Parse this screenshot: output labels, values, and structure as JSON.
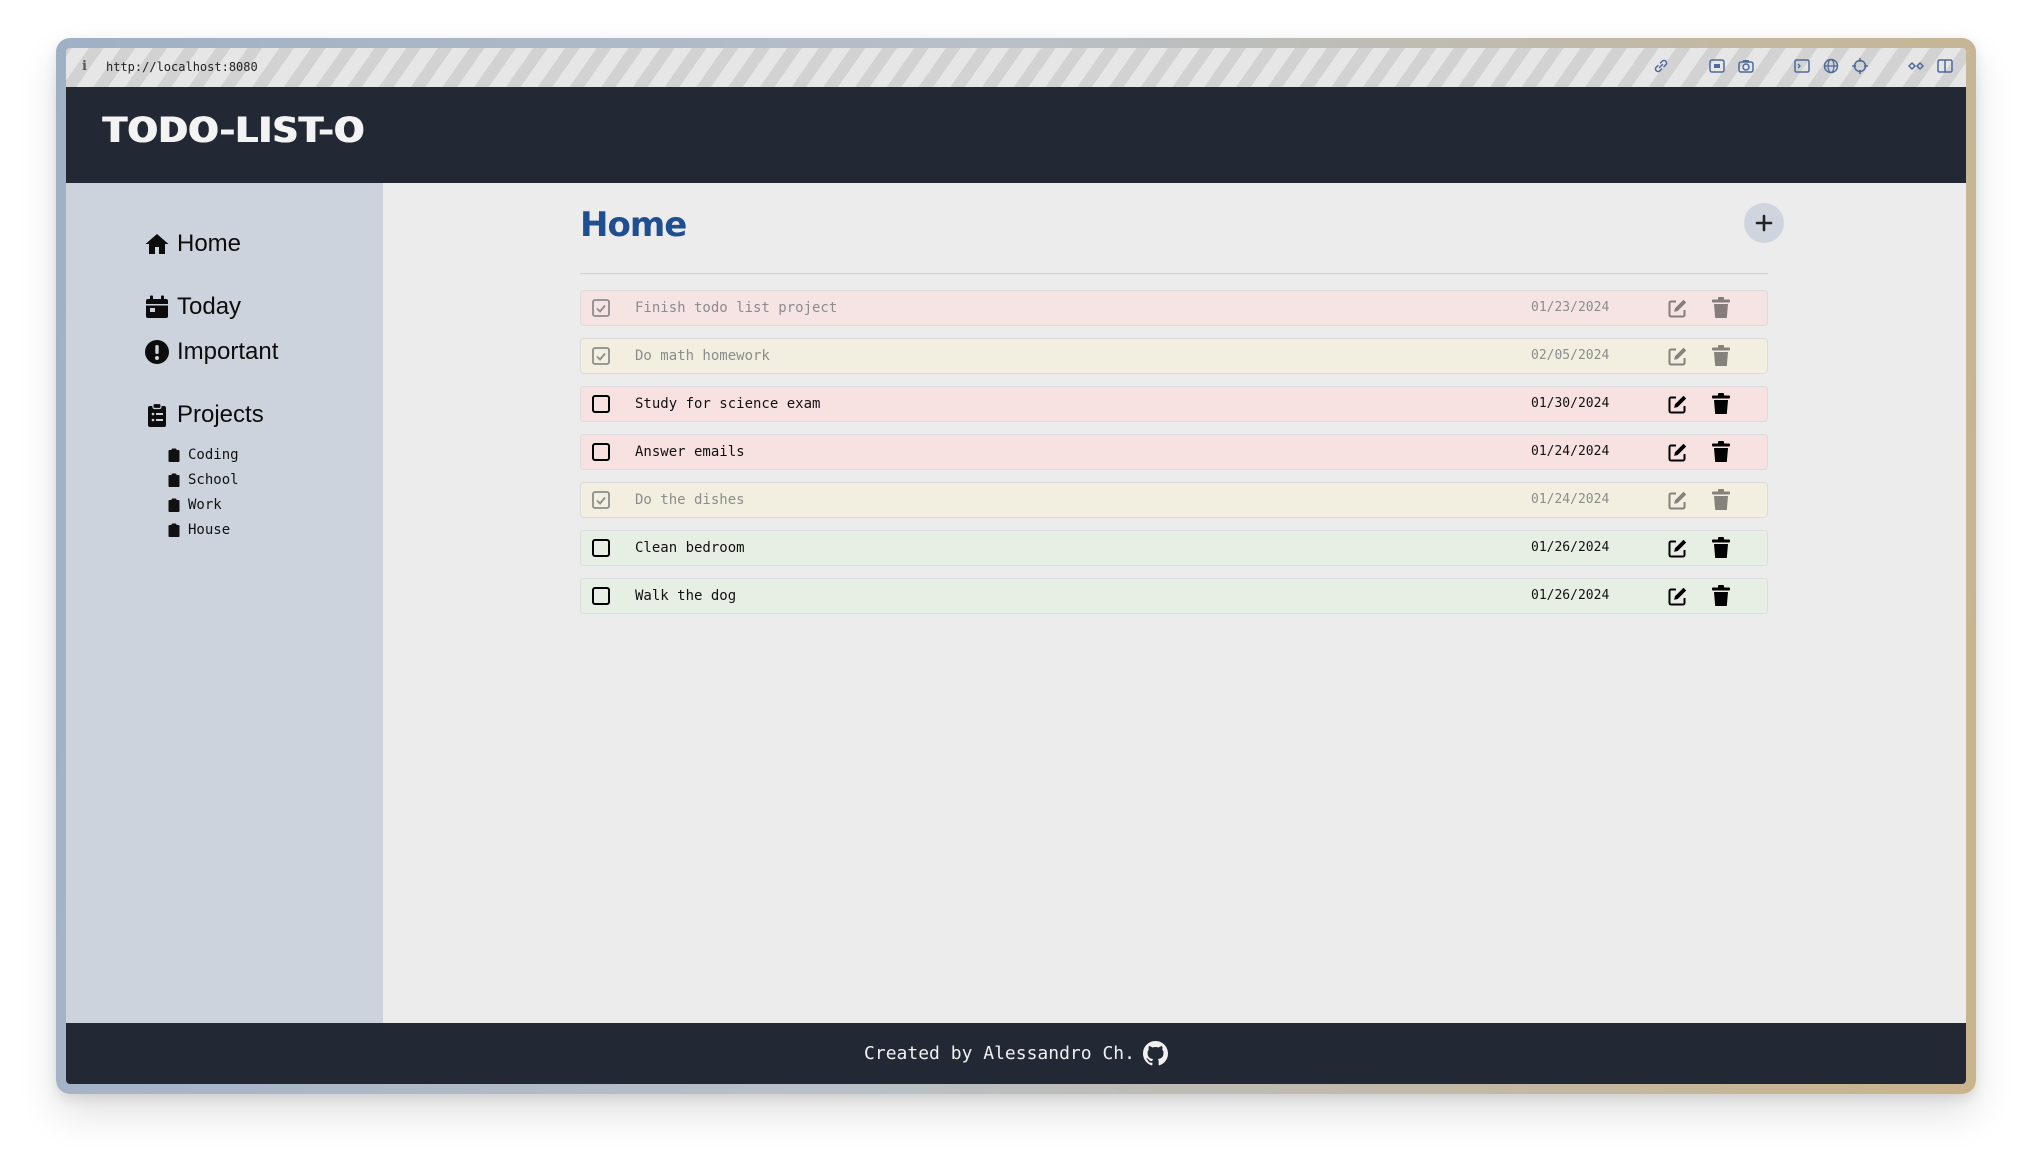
{
  "browser": {
    "url": "http://localhost:8080",
    "info_glyph": "i"
  },
  "app": {
    "brand": "TODO-LIST-O"
  },
  "sidebar": {
    "nav": [
      {
        "label": "Home",
        "icon": "house-icon"
      },
      {
        "label": "Today",
        "icon": "calendar-icon"
      },
      {
        "label": "Important",
        "icon": "exclamation-circle-icon"
      },
      {
        "label": "Projects",
        "icon": "clipboard-icon"
      }
    ],
    "projects": [
      {
        "label": "Coding",
        "icon": "clipboard-icon"
      },
      {
        "label": "School",
        "icon": "clipboard-icon"
      },
      {
        "label": "Work",
        "icon": "clipboard-icon"
      },
      {
        "label": "House",
        "icon": "clipboard-icon"
      }
    ]
  },
  "main": {
    "title": "Home",
    "add_button": "+",
    "tasks": [
      {
        "title": "Finish todo list project",
        "date": "01/23/2024",
        "done": true,
        "priority_color": "#f6e4e4"
      },
      {
        "title": "Do math homework",
        "date": "02/05/2024",
        "done": true,
        "priority_color": "#f2efe0"
      },
      {
        "title": "Study for science exam",
        "date": "01/30/2024",
        "done": false,
        "priority_color": "#f8e1e1"
      },
      {
        "title": "Answer emails",
        "date": "01/24/2024",
        "done": false,
        "priority_color": "#f8e1e1"
      },
      {
        "title": "Do the dishes",
        "date": "01/24/2024",
        "done": true,
        "priority_color": "#f2efe0"
      },
      {
        "title": "Clean bedroom",
        "date": "01/26/2024",
        "done": false,
        "priority_color": "#e7efe4"
      },
      {
        "title": "Walk the dog",
        "date": "01/26/2024",
        "done": false,
        "priority_color": "#e7efe4"
      }
    ]
  },
  "footer": {
    "text": "Created by Alessandro Ch.",
    "icon": "github-icon"
  },
  "colors": {
    "header_bg": "#222834",
    "sidebar_bg": "#cdd3dd",
    "content_bg": "#ececec",
    "title_blue": "#1f4e91"
  }
}
